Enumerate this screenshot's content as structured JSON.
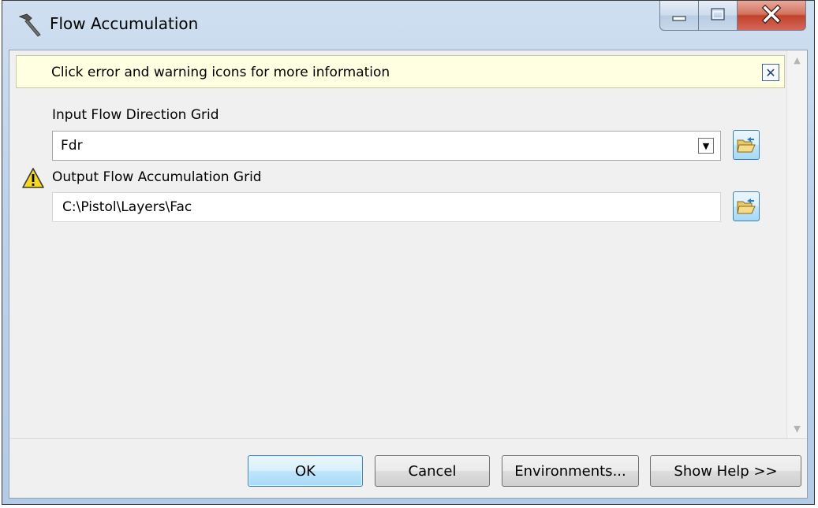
{
  "window": {
    "title": "Flow Accumulation",
    "title_icon": "hammer-icon",
    "caption_buttons": [
      "minimize-icon",
      "maximize-icon",
      "close-icon"
    ]
  },
  "infobar": {
    "message": "Click error and warning icons for more information",
    "close_glyph": "✕"
  },
  "fields": {
    "input_flow_direction": {
      "label": "Input Flow Direction Grid",
      "value": "Fdr",
      "dropdown_glyph": "▼"
    },
    "output_flow_accumulation": {
      "label": "Output Flow Accumulation Grid",
      "value": "C:\\Pistol\\Layers\\Fac",
      "status_icon": "warning-icon"
    }
  },
  "scrollbar": {
    "up_glyph": "▲",
    "down_glyph": "▼"
  },
  "buttons": {
    "ok": "OK",
    "cancel": "Cancel",
    "environments": "Environments...",
    "help": "Show Help >>"
  },
  "colors": {
    "infobar_bg": "#ffffe1",
    "default_button_border": "#3c7fb1",
    "warning_yellow": "#f8d81c"
  }
}
